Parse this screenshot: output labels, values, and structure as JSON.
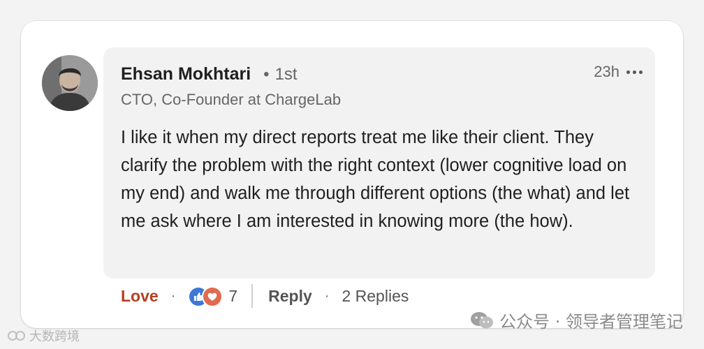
{
  "comment": {
    "author": {
      "name": "Ehsan Mokhtari",
      "degree": "1st",
      "headline": "CTO, Co-Founder at ChargeLab",
      "avatar_icon": "profile-photo"
    },
    "timestamp": "23h",
    "more_icon": "ellipsis-icon",
    "text": "I like it when my direct reports treat me like their client. They clarify the problem with the right context (lower cognitive load on my end) and walk me through different options (the what) and let me ask where I am interested in knowing more (the how)."
  },
  "actions": {
    "reaction_label": "Love",
    "reaction_count": "7",
    "reaction_icons": [
      "like-icon",
      "love-icon"
    ],
    "reply_label": "Reply",
    "replies_label": "2 Replies"
  },
  "watermark": {
    "text": "公众号 · 领导者管理笔记"
  },
  "corner_mark": {
    "text": "大数跨境"
  },
  "colors": {
    "love": "#b24020",
    "like_badge": "#3e78d6",
    "love_badge": "#e06b4f",
    "bubble": "#f2f2f2"
  }
}
